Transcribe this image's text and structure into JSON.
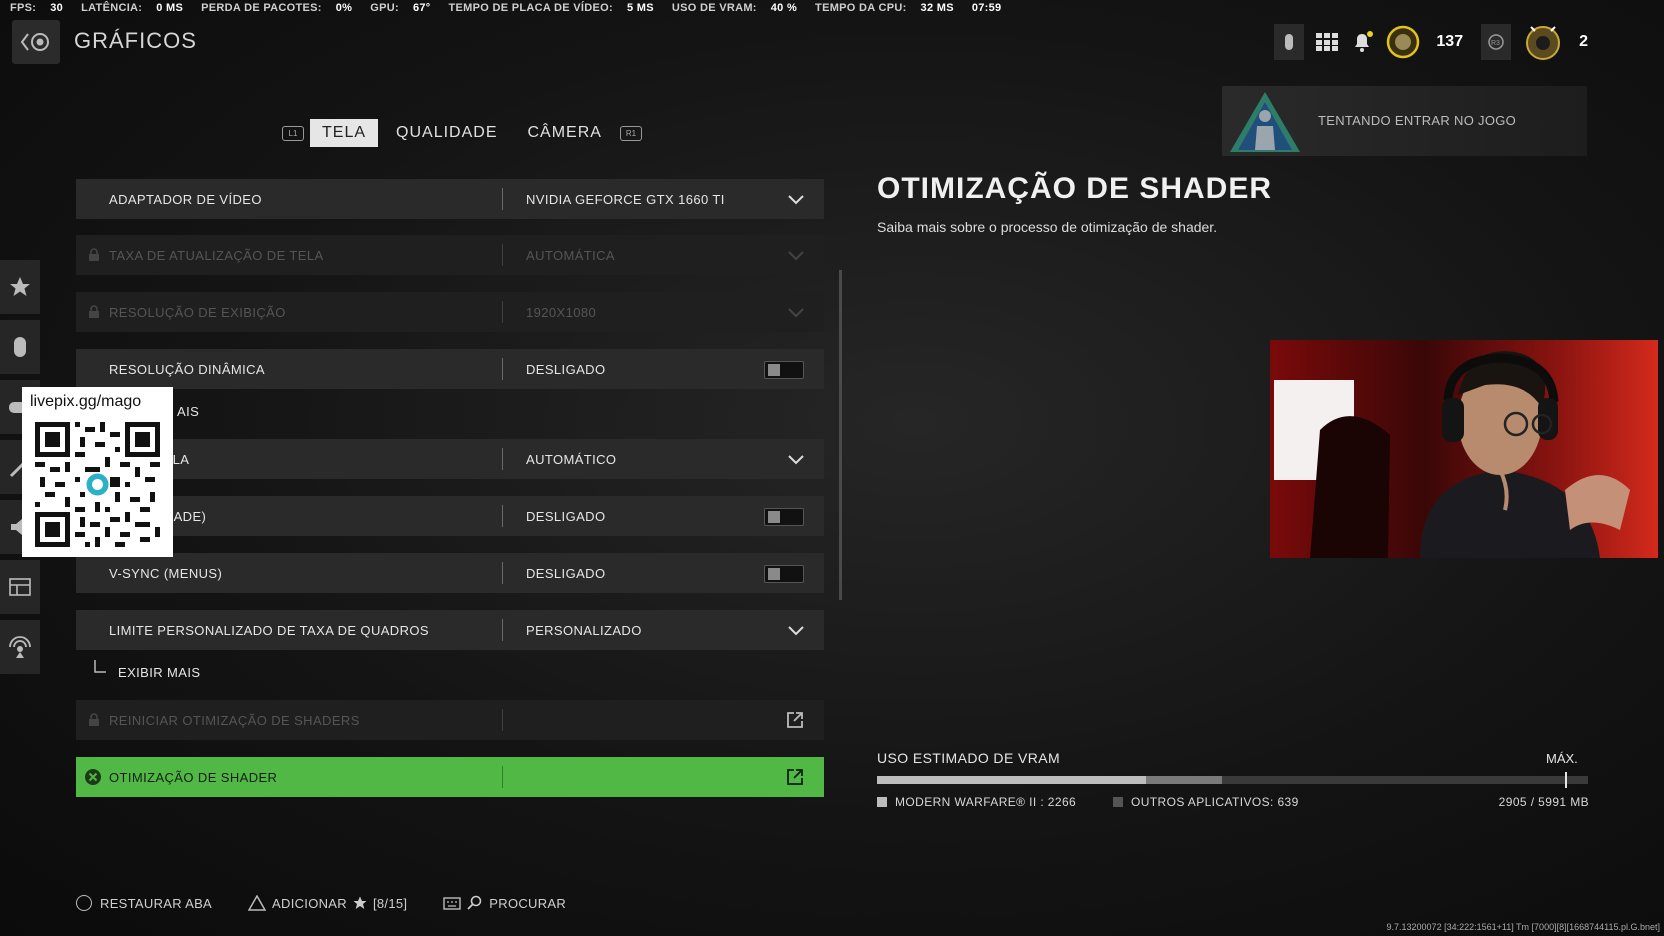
{
  "perf": [
    {
      "label": "FPS:",
      "value": "30"
    },
    {
      "label": "LATÊNCIA:",
      "value": "0 MS"
    },
    {
      "label": "PERDA DE PACOTES:",
      "value": "0%"
    },
    {
      "label": "GPU:",
      "value": "67°"
    },
    {
      "label": "TEMPO DE PLACA DE VÍDEO:",
      "value": "5 MS"
    },
    {
      "label": "USO DE VRAM:",
      "value": "40 %"
    },
    {
      "label": "TEMPO DA CPU:",
      "value": "32 MS"
    },
    {
      "label": "",
      "value": "07:59"
    }
  ],
  "header": {
    "title": "GRÁFICOS",
    "currency_count": "137",
    "player_level": "2"
  },
  "banner": {
    "text": "TENTANDO ENTRAR NO JOGO"
  },
  "tabs": {
    "left_bumper": "L1",
    "right_bumper": "R1",
    "items": [
      "TELA",
      "QUALIDADE",
      "CÂMERA"
    ]
  },
  "settings": [
    {
      "label": "ADAPTADOR DE VÍDEO",
      "value": "NVIDIA GEFORCE GTX 1660 TI"
    },
    {
      "label": "TAXA DE ATUALIZAÇÃO DE TELA",
      "value": "AUTOMÁTICA"
    },
    {
      "label": "RESOLUÇÃO DE EXIBIÇÃO",
      "value": "1920X1080"
    },
    {
      "label": "RESOLUÇÃO DINÂMICA",
      "value": "DESLIGADO"
    },
    {
      "label": "AIS"
    },
    {
      "label": "ÃO DE TELA",
      "value": "AUTOMÁTICO"
    },
    {
      "label": "OGABILIDADE)",
      "value": "DESLIGADO"
    },
    {
      "label": "V-SYNC (MENUS)",
      "value": "DESLIGADO"
    },
    {
      "label": "LIMITE PERSONALIZADO DE TAXA DE QUADROS",
      "value": "PERSONALIZADO"
    },
    {
      "label": "EXIBIR MAIS"
    },
    {
      "label": "REINICIAR OTIMIZAÇÃO DE SHADERS"
    },
    {
      "label": "OTIMIZAÇÃO DE SHADER"
    }
  ],
  "detail": {
    "title": "OTIMIZAÇÃO DE SHADER",
    "description": "Saiba mais sobre o processo de otimização de shader."
  },
  "vram": {
    "title": "USO ESTIMADO DE VRAM",
    "max_label": "MÁX.",
    "game_label": "MODERN WARFARE® II : 2266",
    "other_label": "OUTROS APLICATIVOS: 639",
    "total_label": "2905 / 5991 MB",
    "game_fraction": 0.378,
    "other_fraction": 0.107,
    "max_fraction": 0.967
  },
  "overlay": {
    "qr_text": "livepix.gg/mago"
  },
  "footer": {
    "restore": "RESTAURAR ABA",
    "add": "ADICIONAR",
    "add_count": "[8/15]",
    "search": "PROCURAR"
  },
  "build": "9.7.13200072 [34:222:1561+11] Tm [7000][8][1668744115.pl.G.bnet]",
  "colors": {
    "accent": "#52b845",
    "row_bg": "#2a2a2a"
  }
}
